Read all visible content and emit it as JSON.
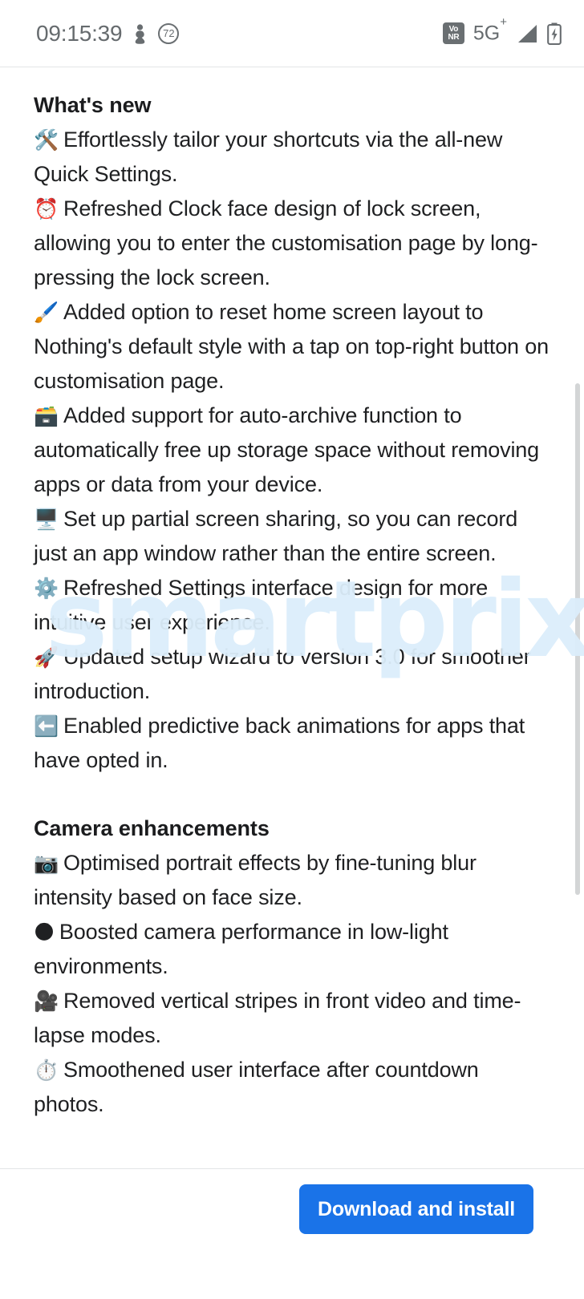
{
  "status_bar": {
    "clock": "09:15:39",
    "left_icons": [
      {
        "name": "vibrate-icon",
        "glyph": "⛏"
      },
      {
        "name": "notification-count-badge",
        "label": "72"
      }
    ],
    "right_icons": [
      {
        "name": "vonr-badge",
        "line1": "Vo",
        "line2": "NR"
      },
      {
        "name": "network-type-label",
        "label": "5G",
        "superscript": "+"
      },
      {
        "name": "signal-strength-icon"
      },
      {
        "name": "battery-charging-icon"
      }
    ]
  },
  "colors": {
    "accent": "#1a73e8",
    "text": "#1f2022",
    "heading": "#1b1c1e",
    "status_text": "#666b6e",
    "divider": "#e3e5e6",
    "scrollbar": "#d3d5d6",
    "watermark": "#dceefb"
  },
  "watermark": {
    "text": "smartprix"
  },
  "sections": [
    {
      "title": "What's new",
      "bullets": [
        {
          "emoji": "🛠️",
          "icon_name": "hammer-and-wrench-icon",
          "text": "Effortlessly tailor your shortcuts via the all-new Quick Settings."
        },
        {
          "emoji": "⏰",
          "icon_name": "alarm-clock-icon",
          "text": "Refreshed Clock face design of lock screen, allowing you to enter the customisation page by long-pressing the lock screen."
        },
        {
          "emoji": "🖌️",
          "icon_name": "paintbrush-icon",
          "text": "Added option to reset home screen layout to Nothing's default style with a tap on top-right button on customisation page."
        },
        {
          "emoji": "🗃️",
          "icon_name": "card-file-box-icon",
          "text": "Added support for auto-archive function to automatically free up storage space without removing apps or data from your device."
        },
        {
          "emoji": "🖥️",
          "icon_name": "desktop-computer-icon",
          "text": "Set up partial screen sharing, so you can record just an app window rather than the entire screen."
        },
        {
          "emoji": "⚙️",
          "icon_name": "gear-icon",
          "text": "Refreshed Settings interface design for more intuitive user experience."
        },
        {
          "emoji": "🚀",
          "icon_name": "rocket-icon",
          "text": "Updated setup wizard to version 3.0 for smoother introduction."
        },
        {
          "emoji": "⬅️",
          "icon_name": "left-arrow-icon",
          "text": "Enabled predictive back animations for apps that have opted in."
        }
      ]
    },
    {
      "title": "Camera enhancements",
      "bullets": [
        {
          "emoji": "📷",
          "icon_name": "camera-icon",
          "text": "Optimised portrait effects by fine-tuning blur intensity based on face size."
        },
        {
          "emoji": "🌑",
          "icon_name": "new-moon-icon",
          "text": "Boosted camera performance in low-light environments."
        },
        {
          "emoji": "🎥",
          "icon_name": "movie-camera-icon",
          "text": "Removed vertical stripes in front video and time-lapse modes."
        },
        {
          "emoji": "⏱️",
          "icon_name": "stopwatch-icon",
          "text": "Smoothened user interface after countdown photos."
        }
      ]
    }
  ],
  "footer": {
    "download_label": "Download and install"
  }
}
